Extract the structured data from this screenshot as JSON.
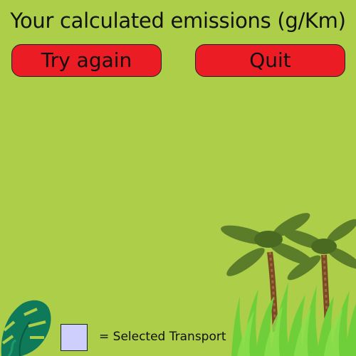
{
  "header": {
    "title": "Your calculated emissions (g/Km)"
  },
  "buttons": {
    "try_again": "Try again",
    "quit": "Quit"
  },
  "legend": {
    "label": "= Selected Transport",
    "swatch_color": "#cfcffd"
  },
  "colors": {
    "background": "#acce48",
    "button": "#ec1c24"
  },
  "decorations": {
    "left": "monstera-leaf-icon",
    "right": "palm-trees-grass-icon"
  }
}
